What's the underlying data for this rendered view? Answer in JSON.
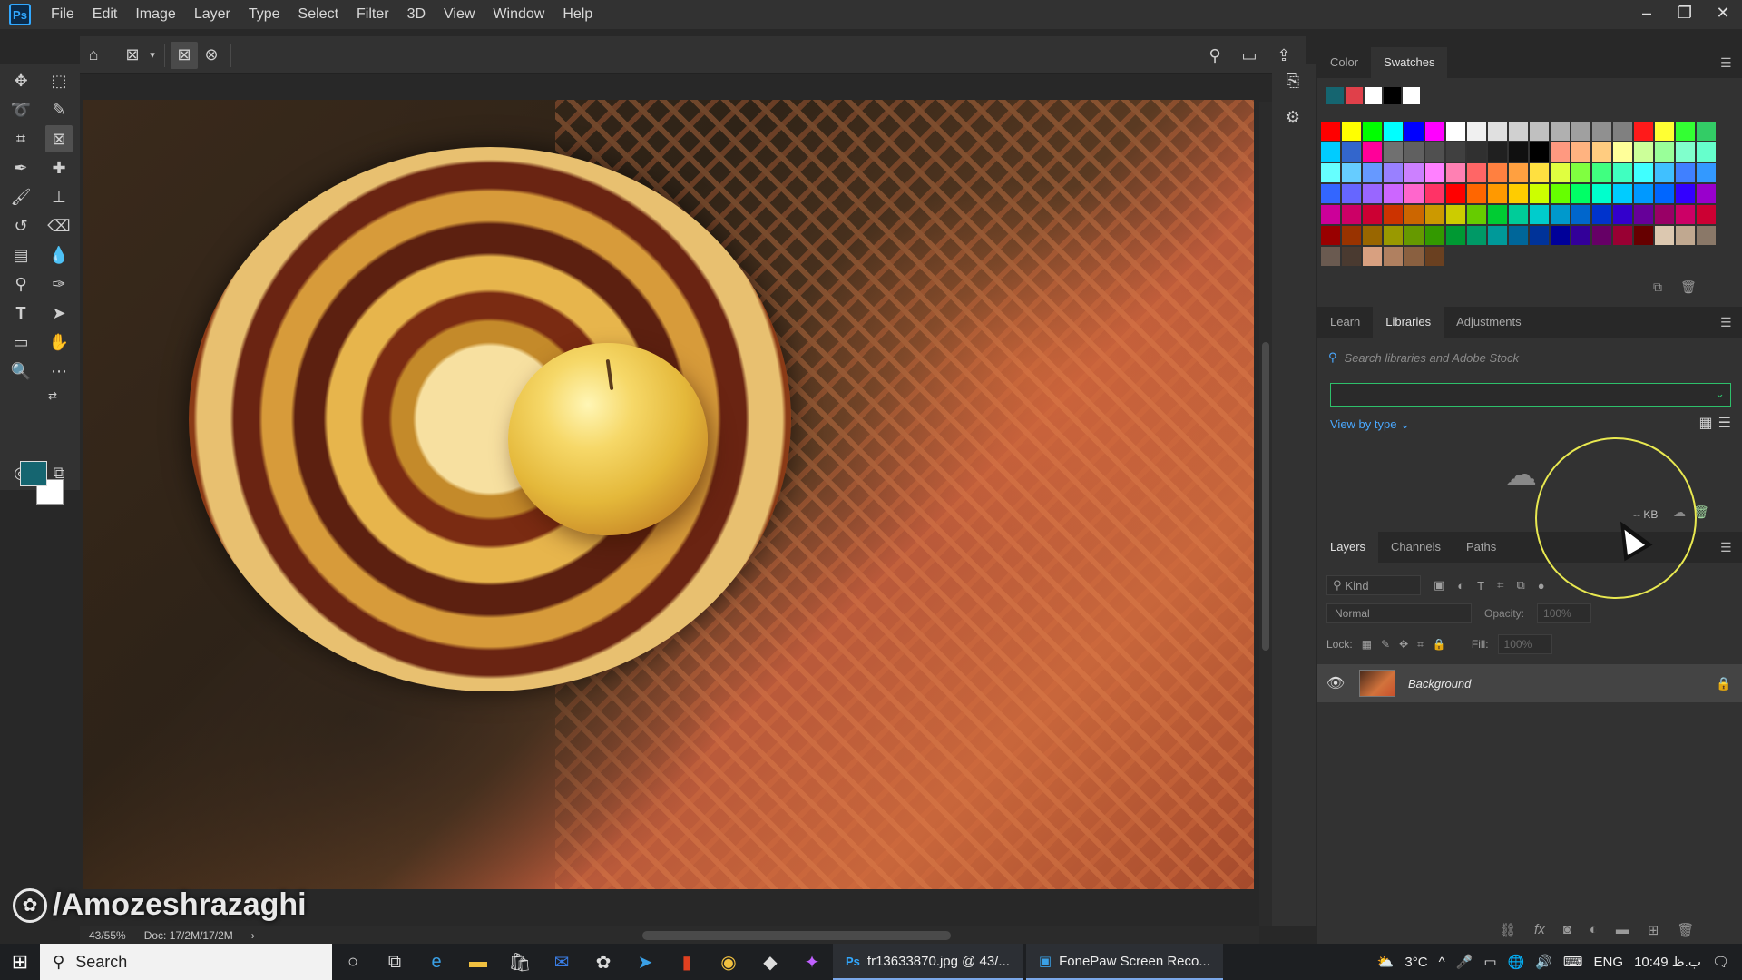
{
  "app": {
    "logo": "Ps"
  },
  "menu": [
    "File",
    "Edit",
    "Image",
    "Layer",
    "Type",
    "Select",
    "Filter",
    "3D",
    "View",
    "Window",
    "Help"
  ],
  "window_controls": {
    "minimize": "–",
    "restore": "❐",
    "close": "✕"
  },
  "options_bar": {
    "home_icon": "home-icon",
    "frame_icon": "frame-tool-icon",
    "dropdown": "▾",
    "rect_frame": "rectangle-frame-icon",
    "ellipse_frame": "ellipse-frame-icon"
  },
  "status": {
    "zoom": "43/55%",
    "doc": "Doc: 17/2M/17/2M",
    "arrow": "›"
  },
  "watermark": {
    "text": "/Amozeshrazaghi"
  },
  "colors": {
    "foreground": "#156570",
    "background": "#ffffff",
    "accent": "#31a8ff",
    "library_green": "#2ec06b"
  },
  "swatches_panel": {
    "tabs": [
      "Color",
      "Swatches"
    ],
    "active_tab": "Swatches",
    "recent": [
      "#156570",
      "#e0404a",
      "#ffffff",
      "#000000",
      "#ffffff"
    ],
    "grid": [
      "#ff0000",
      "#ffff00",
      "#00ff00",
      "#00ffff",
      "#0000ff",
      "#ff00ff",
      "#ffffff",
      "#f0f0f0",
      "#e0e0e0",
      "#d0d0d0",
      "#c0c0c0",
      "#b0b0b0",
      "#a0a0a0",
      "#909090",
      "#808080",
      "#ff1a1a",
      "#ffff33",
      "#33ff33",
      "#33cc66",
      "#00ccff",
      "#3366cc",
      "#ff0099",
      "#707070",
      "#606060",
      "#505050",
      "#404040",
      "#303030",
      "#202020",
      "#101010",
      "#000000",
      "#ff9980",
      "#ffb380",
      "#ffcc80",
      "#ffff99",
      "#ccff99",
      "#99ff99",
      "#80ffcc",
      "#66ffcc",
      "#66ffff",
      "#66ccff",
      "#6699ff",
      "#9980ff",
      "#cc80ff",
      "#ff80ff",
      "#ff80b3",
      "#ff6666",
      "#ff8040",
      "#ffa040",
      "#ffe040",
      "#e0ff40",
      "#80ff40",
      "#40ff80",
      "#40ffc0",
      "#40ffff",
      "#40c0ff",
      "#4080ff",
      "#3399ff",
      "#3366ff",
      "#6666ff",
      "#9966ff",
      "#cc66ff",
      "#ff66cc",
      "#ff3366",
      "#ff0000",
      "#ff6600",
      "#ff9900",
      "#ffcc00",
      "#ccff00",
      "#66ff00",
      "#00ff66",
      "#00ffcc",
      "#00ccff",
      "#0099ff",
      "#0066ff",
      "#3300ff",
      "#9900cc",
      "#cc0099",
      "#cc0066",
      "#cc0033",
      "#cc3300",
      "#cc6600",
      "#cc9900",
      "#cccc00",
      "#66cc00",
      "#00cc33",
      "#00cc99",
      "#00cccc",
      "#0099cc",
      "#0066cc",
      "#0033cc",
      "#3300cc",
      "#660099",
      "#990066",
      "#cc0066",
      "#cc0033",
      "#990000",
      "#993300",
      "#996600",
      "#999900",
      "#669900",
      "#339900",
      "#009933",
      "#009966",
      "#009999",
      "#006699",
      "#003399",
      "#000099",
      "#330099",
      "#660066",
      "#990033",
      "#660000",
      "#dcc8b0",
      "#c0a890",
      "#8a7868",
      "#6a5a50",
      "#4a3a30",
      "#d8a080",
      "#b08060",
      "#8a6040",
      "#6a4020"
    ]
  },
  "libraries_panel": {
    "tabs": [
      "Learn",
      "Libraries",
      "Adjustments"
    ],
    "active_tab": "Libraries",
    "search_placeholder": "Search libraries and Adobe Stock",
    "view_by_type": "View by type ⌄",
    "kb": "-- KB"
  },
  "layers_panel": {
    "tabs": [
      "Layers",
      "Channels",
      "Paths"
    ],
    "active_tab": "Layers",
    "kind": "Kind",
    "blend_mode": "Normal",
    "opacity_label": "Opacity:",
    "opacity_value": "100%",
    "lock_label": "Lock:",
    "fill_label": "Fill:",
    "fill_value": "100%",
    "layers": [
      {
        "name": "Background",
        "visible": true,
        "locked": true
      }
    ]
  },
  "taskbar": {
    "search_label": "Search",
    "apps": [
      {
        "label": "fr13633870.jpg @ 43/..."
      },
      {
        "label": "FonePaw Screen Reco..."
      }
    ],
    "tray": {
      "temperature": "3°C",
      "language": "ENG",
      "time": "10:49 ب.ظ"
    }
  }
}
